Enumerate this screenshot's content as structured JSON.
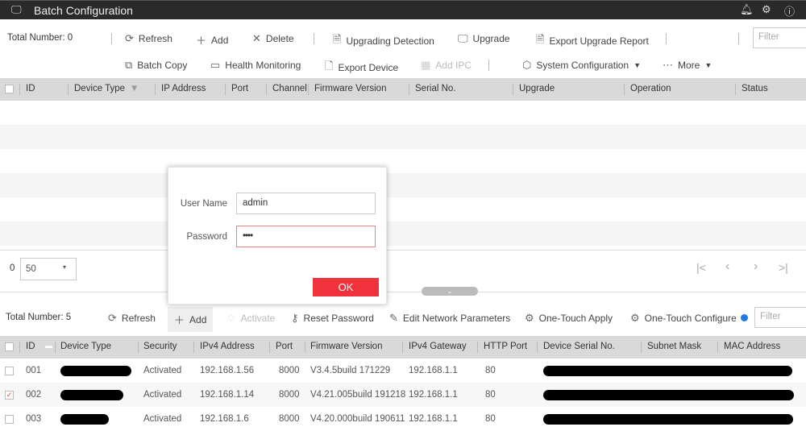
{
  "window": {
    "title": "Batch Configuration",
    "icons": [
      "monitor-app-icon",
      "bell-icon",
      "gear-icon",
      "info-icon"
    ]
  },
  "top": {
    "total": "Total Number: 0",
    "toolbar1": {
      "refresh": "Refresh",
      "add": "Add",
      "delete": "Delete",
      "upgrading_detection": "Upgrading Detection",
      "upgrade": "Upgrade",
      "export_upgrade_report": "Export Upgrade Report"
    },
    "filter_placeholder": "Filter",
    "toolbar2": {
      "batch_copy": "Batch Copy",
      "health_monitoring": "Health Monitoring",
      "export_device": "Export Device",
      "add_ipc": "Add IPC",
      "system_configuration": "System Configuration",
      "more": "More"
    },
    "columns": [
      "ID",
      "Device Type",
      "IP Address",
      "Port",
      "Channel",
      "Firmware Version",
      "Serial No.",
      "Upgrade",
      "Operation",
      "Status"
    ],
    "pagination": {
      "count": "0",
      "page_size": "50"
    }
  },
  "dialog": {
    "username_label": "User Name",
    "username_value": "admin",
    "password_label": "Password",
    "password_value": "••••",
    "ok": "OK"
  },
  "bottom": {
    "total": "Total Number: 5",
    "toolbar": {
      "refresh": "Refresh",
      "add": "Add",
      "activate": "Activate",
      "reset_password": "Reset Password",
      "edit_network": "Edit Network Parameters",
      "one_touch_apply": "One-Touch Apply",
      "one_touch_configure": "One-Touch Configure"
    },
    "filter_placeholder": "Filter",
    "columns": [
      "ID",
      "Device Type",
      "Security",
      "IPv4 Address",
      "Port",
      "Firmware Version",
      "IPv4 Gateway",
      "HTTP Port",
      "Device Serial No.",
      "Subnet Mask",
      "MAC Address"
    ],
    "rows": [
      {
        "checked": false,
        "id": "001",
        "security": "Activated",
        "ip": "192.168.1.56",
        "port": "8000",
        "firmware": "V3.4.5build 171229",
        "gateway": "192.168.1.1",
        "http": "80"
      },
      {
        "checked": true,
        "id": "002",
        "security": "Activated",
        "ip": "192.168.1.14",
        "port": "8000",
        "firmware": "V4.21.005build 191218",
        "gateway": "192.168.1.1",
        "http": "80"
      },
      {
        "checked": false,
        "id": "003",
        "security": "Activated",
        "ip": "192.168.1.6",
        "port": "8000",
        "firmware": "V4.20.000build 190611",
        "gateway": "192.168.1.1",
        "http": "80"
      }
    ]
  },
  "colors": {
    "accent": "#f0323c",
    "titlebar": "#2a2a2a",
    "header": "#d9d9d9",
    "info": "#1e7be0"
  }
}
